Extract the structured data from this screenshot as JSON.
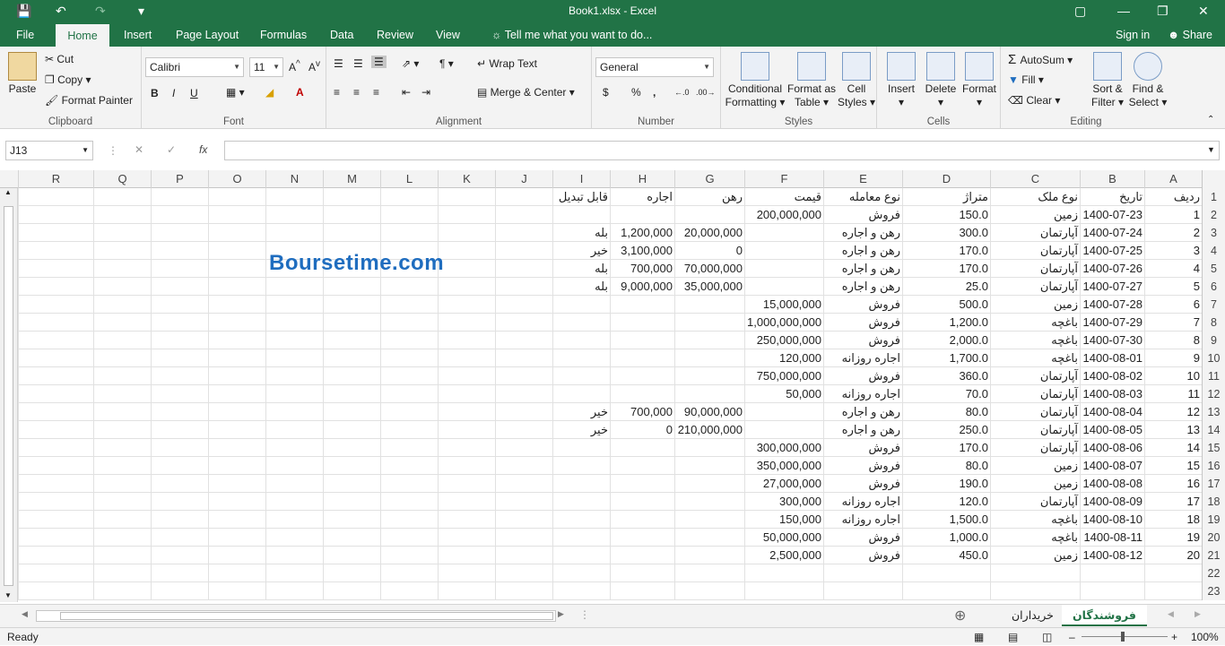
{
  "title": "Book1.xlsx - Excel",
  "tabs": [
    "File",
    "Home",
    "Insert",
    "Page Layout",
    "Formulas",
    "Data",
    "Review",
    "View"
  ],
  "tell_me": "Tell me what you want to do...",
  "sign_in": "Sign in",
  "share": "Share",
  "ribbon": {
    "clipboard": {
      "paste": "Paste",
      "cut": "Cut",
      "copy": "Copy",
      "format_painter": "Format Painter",
      "label": "Clipboard"
    },
    "font": {
      "name": "Calibri",
      "size": "11",
      "label": "Font",
      "bold": "B",
      "italic": "I",
      "underline": "U"
    },
    "alignment": {
      "wrap": "Wrap Text",
      "merge": "Merge & Center",
      "label": "Alignment"
    },
    "number": {
      "format": "General",
      "label": "Number",
      "currency": "$",
      "percent": "%",
      "comma": ","
    },
    "styles": {
      "conditional": "Conditional",
      "formatting": "Formatting",
      "format_as": "Format as",
      "table": "Table",
      "cell": "Cell",
      "cell_styles": "Styles",
      "label": "Styles"
    },
    "cells": {
      "insert": "Insert",
      "delete": "Delete",
      "format": "Format",
      "label": "Cells"
    },
    "editing": {
      "autosum": "AutoSum",
      "fill": "Fill",
      "clear": "Clear",
      "sort": "Sort &",
      "filter": "Filter",
      "find": "Find &",
      "select": "Select",
      "label": "Editing"
    }
  },
  "name_box": "J13",
  "fx": "fx",
  "columns": [
    "R",
    "Q",
    "P",
    "O",
    "N",
    "M",
    "L",
    "K",
    "J",
    "I",
    "H",
    "G",
    "F",
    "E",
    "D",
    "C",
    "B",
    "A"
  ],
  "rows": [
    {
      "n": "1",
      "A": "ردیف",
      "B": "تاریخ",
      "C": "نوع ملک",
      "D": "متراژ",
      "E": "نوع معامله",
      "F": "قیمت",
      "G": "رهن",
      "H": "اجاره",
      "I": "قابل تبدیل"
    },
    {
      "n": "2",
      "A": "1",
      "B": "1400-07-23",
      "C": "زمین",
      "D": "150.0",
      "E": "فروش",
      "F": "200,000,000",
      "G": "",
      "H": "",
      "I": ""
    },
    {
      "n": "3",
      "A": "2",
      "B": "1400-07-24",
      "C": "آپارتمان",
      "D": "300.0",
      "E": "رهن و اجاره",
      "F": "",
      "G": "20,000,000",
      "H": "1,200,000",
      "I": "بله"
    },
    {
      "n": "4",
      "A": "3",
      "B": "1400-07-25",
      "C": "آپارتمان",
      "D": "170.0",
      "E": "رهن و اجاره",
      "F": "",
      "G": "0",
      "H": "3,100,000",
      "I": "خیر"
    },
    {
      "n": "5",
      "A": "4",
      "B": "1400-07-26",
      "C": "آپارتمان",
      "D": "170.0",
      "E": "رهن و اجاره",
      "F": "",
      "G": "70,000,000",
      "H": "700,000",
      "I": "بله"
    },
    {
      "n": "6",
      "A": "5",
      "B": "1400-07-27",
      "C": "آپارتمان",
      "D": "25.0",
      "E": "رهن و اجاره",
      "F": "",
      "G": "35,000,000",
      "H": "9,000,000",
      "I": "بله"
    },
    {
      "n": "7",
      "A": "6",
      "B": "1400-07-28",
      "C": "زمین",
      "D": "500.0",
      "E": "فروش",
      "F": "15,000,000",
      "G": "",
      "H": "",
      "I": ""
    },
    {
      "n": "8",
      "A": "7",
      "B": "1400-07-29",
      "C": "باغچه",
      "D": "1,200.0",
      "E": "فروش",
      "F": "1,000,000,000",
      "G": "",
      "H": "",
      "I": ""
    },
    {
      "n": "9",
      "A": "8",
      "B": "1400-07-30",
      "C": "باغچه",
      "D": "2,000.0",
      "E": "فروش",
      "F": "250,000,000",
      "G": "",
      "H": "",
      "I": ""
    },
    {
      "n": "10",
      "A": "9",
      "B": "1400-08-01",
      "C": "باغچه",
      "D": "1,700.0",
      "E": "اجاره روزانه",
      "F": "120,000",
      "G": "",
      "H": "",
      "I": ""
    },
    {
      "n": "11",
      "A": "10",
      "B": "1400-08-02",
      "C": "آپارتمان",
      "D": "360.0",
      "E": "فروش",
      "F": "750,000,000",
      "G": "",
      "H": "",
      "I": ""
    },
    {
      "n": "12",
      "A": "11",
      "B": "1400-08-03",
      "C": "آپارتمان",
      "D": "70.0",
      "E": "اجاره روزانه",
      "F": "50,000",
      "G": "",
      "H": "",
      "I": ""
    },
    {
      "n": "13",
      "A": "12",
      "B": "1400-08-04",
      "C": "آپارتمان",
      "D": "80.0",
      "E": "رهن و اجاره",
      "F": "",
      "G": "90,000,000",
      "H": "700,000",
      "I": "خیر"
    },
    {
      "n": "14",
      "A": "13",
      "B": "1400-08-05",
      "C": "آپارتمان",
      "D": "250.0",
      "E": "رهن و اجاره",
      "F": "",
      "G": "210,000,000",
      "H": "0",
      "I": "خیر"
    },
    {
      "n": "15",
      "A": "14",
      "B": "1400-08-06",
      "C": "آپارتمان",
      "D": "170.0",
      "E": "فروش",
      "F": "300,000,000",
      "G": "",
      "H": "",
      "I": ""
    },
    {
      "n": "16",
      "A": "15",
      "B": "1400-08-07",
      "C": "زمین",
      "D": "80.0",
      "E": "فروش",
      "F": "350,000,000",
      "G": "",
      "H": "",
      "I": ""
    },
    {
      "n": "17",
      "A": "16",
      "B": "1400-08-08",
      "C": "زمین",
      "D": "190.0",
      "E": "فروش",
      "F": "27,000,000",
      "G": "",
      "H": "",
      "I": ""
    },
    {
      "n": "18",
      "A": "17",
      "B": "1400-08-09",
      "C": "آپارتمان",
      "D": "120.0",
      "E": "اجاره روزانه",
      "F": "300,000",
      "G": "",
      "H": "",
      "I": ""
    },
    {
      "n": "19",
      "A": "18",
      "B": "1400-08-10",
      "C": "باغچه",
      "D": "1,500.0",
      "E": "اجاره روزانه",
      "F": "150,000",
      "G": "",
      "H": "",
      "I": ""
    },
    {
      "n": "20",
      "A": "19",
      "B": "1400-08-11",
      "C": "باغچه",
      "D": "1,000.0",
      "E": "فروش",
      "F": "50,000,000",
      "G": "",
      "H": "",
      "I": ""
    },
    {
      "n": "21",
      "A": "20",
      "B": "1400-08-12",
      "C": "زمین",
      "D": "450.0",
      "E": "فروش",
      "F": "2,500,000",
      "G": "",
      "H": "",
      "I": ""
    },
    {
      "n": "22",
      "A": "",
      "B": "",
      "C": "",
      "D": "",
      "E": "",
      "F": "",
      "G": "",
      "H": "",
      "I": ""
    },
    {
      "n": "23",
      "A": "",
      "B": "",
      "C": "",
      "D": "",
      "E": "",
      "F": "",
      "G": "",
      "H": "",
      "I": ""
    }
  ],
  "watermark": "Boursetime.com",
  "sheets": [
    "فروشندگان",
    "خریداران"
  ],
  "status": "Ready",
  "zoom": "100%"
}
